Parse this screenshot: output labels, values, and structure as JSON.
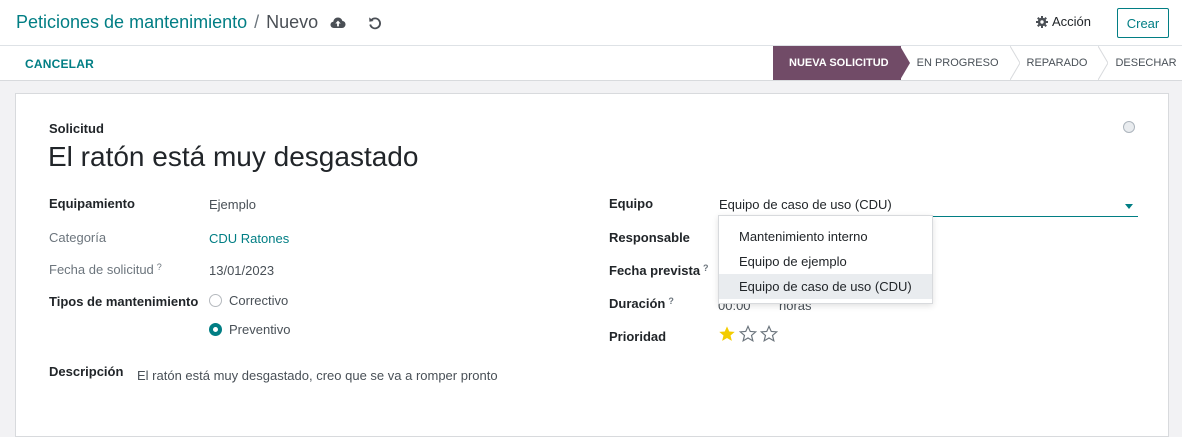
{
  "breadcrumb": {
    "parent": "Peticiones de mantenimiento",
    "separator": "/",
    "current": "Nuevo"
  },
  "icons": {
    "save": "cloud-upload-icon",
    "discard": "undo-icon",
    "action": "gear-icon",
    "status": "circle-icon",
    "caret": "caret-down-icon",
    "priority": "star-icon"
  },
  "toolbar": {
    "action_label": "Acción",
    "create_label": "Crear",
    "cancel_label": "CANCELAR"
  },
  "statusbar": {
    "stages": [
      "NUEVA SOLICITUD",
      "EN PROGRESO",
      "REPARADO",
      "DESECHAR"
    ],
    "active_index": 0
  },
  "form": {
    "section_label": "Solicitud",
    "title": "El ratón está muy desgastado",
    "equipment_label": "Equipamiento",
    "equipment_value": "Ejemplo",
    "category_label": "Categoría",
    "category_value": "CDU Ratones",
    "request_date_label": "Fecha de solicitud",
    "request_date_help": "?",
    "request_date_value": "13/01/2023",
    "maintenance_type_label": "Tipos de mantenimiento",
    "maintenance_types": [
      "Correctivo",
      "Preventivo"
    ],
    "maintenance_type_selected": "Preventivo",
    "description_label": "Descripción",
    "description_value": "El ratón está muy desgastado, creo que se va a romper pronto",
    "team_label": "Equipo",
    "team_value": "Equipo de caso de uso (CDU)",
    "responsible_label": "Responsable",
    "scheduled_date_label": "Fecha prevista",
    "scheduled_date_help": "?",
    "duration_label": "Duración",
    "duration_help": "?",
    "duration_value": "00:00",
    "duration_unit": "horas",
    "priority_label": "Prioridad",
    "priority_value": 1,
    "priority_max": 3
  },
  "team_dropdown": {
    "options": [
      "Mantenimiento interno",
      "Equipo de ejemplo",
      "Equipo de caso de uso (CDU)"
    ],
    "highlighted_index": 2
  },
  "colors": {
    "accent": "#017e84",
    "stage_active": "#714b67",
    "star_filled": "#f3cc00",
    "star_empty": "#6c757d"
  }
}
